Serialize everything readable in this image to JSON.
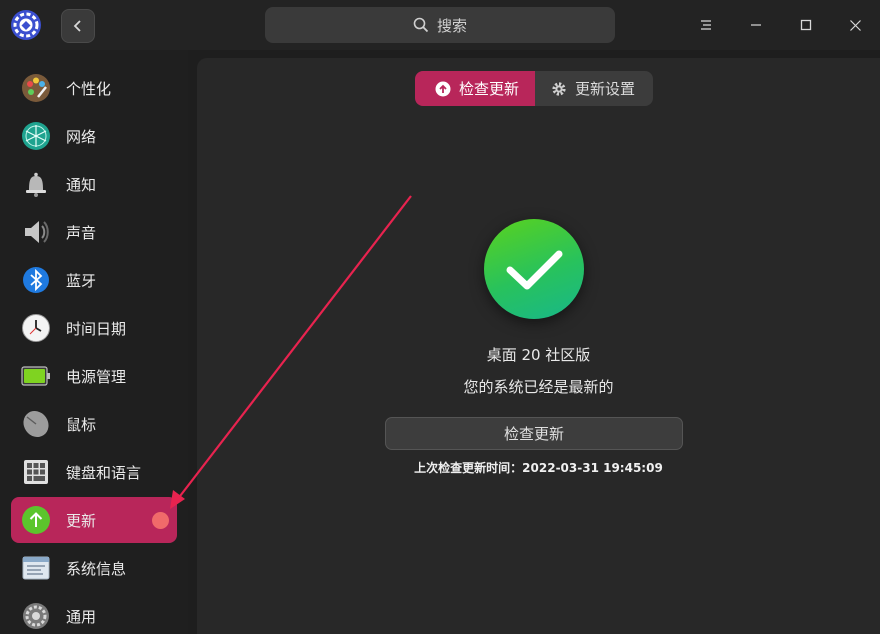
{
  "header": {
    "search_label": "搜索"
  },
  "sidebar": {
    "items": [
      {
        "label": "个性化",
        "icon": "palette-icon"
      },
      {
        "label": "网络",
        "icon": "network-icon"
      },
      {
        "label": "通知",
        "icon": "bell-icon"
      },
      {
        "label": "声音",
        "icon": "speaker-icon"
      },
      {
        "label": "蓝牙",
        "icon": "bluetooth-icon"
      },
      {
        "label": "时间日期",
        "icon": "clock-icon"
      },
      {
        "label": "电源管理",
        "icon": "battery-icon"
      },
      {
        "label": "鼠标",
        "icon": "mouse-icon"
      },
      {
        "label": "键盘和语言",
        "icon": "keyboard-icon"
      },
      {
        "label": "更新",
        "icon": "update-icon",
        "active": true,
        "badge": true
      },
      {
        "label": "系统信息",
        "icon": "system-info-icon"
      },
      {
        "label": "通用",
        "icon": "general-icon"
      }
    ]
  },
  "main": {
    "tabs": [
      {
        "label": "检查更新",
        "icon": "upload-icon",
        "active": true
      },
      {
        "label": "更新设置",
        "icon": "gear-icon",
        "active": false
      }
    ],
    "edition": "桌面 20 社区版",
    "status": "您的系统已经是最新的",
    "check_button": "检查更新",
    "last_check": "上次检查更新时间：2022-03-31 19:45:09"
  },
  "colors": {
    "accent": "#b8265a",
    "success": "#28c25c",
    "annotation_arrow": "#e8234f"
  }
}
